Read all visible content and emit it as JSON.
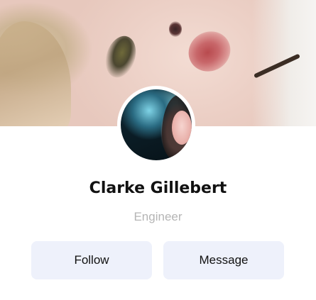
{
  "profile": {
    "name": "Clarke Gillebert",
    "role": "Engineer"
  },
  "actions": {
    "follow_label": "Follow",
    "message_label": "Message"
  },
  "colors": {
    "button_bg": "#eef1fb",
    "role_text": "#b5b5b5",
    "name_text": "#111111"
  }
}
